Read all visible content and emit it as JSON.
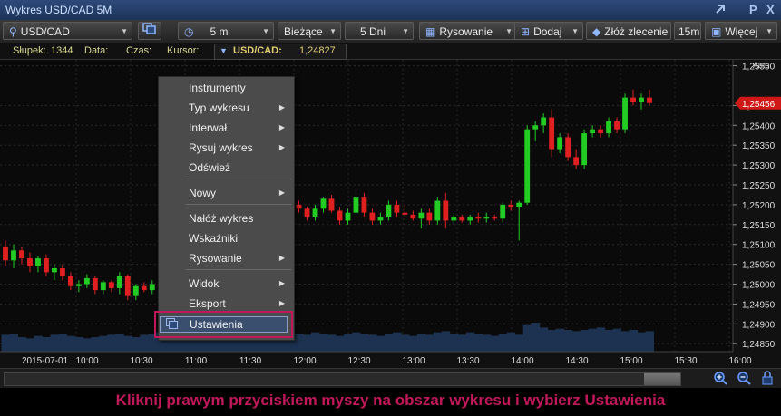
{
  "window": {
    "title": "Wykres USD/CAD 5M",
    "pin_glyph": "P",
    "close_glyph": "X"
  },
  "toolbar": {
    "symbol": "USD/CAD",
    "interval": "5 m",
    "type": "Bieżące",
    "range": "5 Dni",
    "draw": "Rysowanie",
    "add": "Dodaj",
    "order": "Złóż zlecenie",
    "quick_interval": "15m",
    "more": "Więcej"
  },
  "infobar": {
    "bar_label": "Słupek:",
    "bar_value": "1344",
    "date_label": "Data:",
    "time_label": "Czas:",
    "cursor_label": "Kursor:",
    "pair": "USD/CAD:",
    "price": "1,24827"
  },
  "price_axis": {
    "auto_label": "Auto",
    "labels": [
      "1,25550",
      "1,25450",
      "1,25400",
      "1,25350",
      "1,25300",
      "1,25250",
      "1,25200",
      "1,25150",
      "1,25100",
      "1,25050",
      "1,25000",
      "1,24950",
      "1,24900",
      "1,24850"
    ],
    "current_price": "1,25456"
  },
  "time_axis": {
    "labels": [
      "2015-07-01",
      "10:00",
      "10:30",
      "11:00",
      "11:30",
      "12:00",
      "12:30",
      "13:00",
      "13:30",
      "14:00",
      "14:30",
      "15:00",
      "15:30",
      "16:00"
    ]
  },
  "context_menu": {
    "items": [
      {
        "label": "Instrumenty",
        "submenu": false
      },
      {
        "label": "Typ wykresu",
        "submenu": true
      },
      {
        "label": "Interwał",
        "submenu": true
      },
      {
        "label": "Rysuj wykres",
        "submenu": true
      },
      {
        "label": "Odśwież",
        "submenu": false
      },
      {
        "label": "Nowy",
        "submenu": true
      },
      {
        "label": "Nałóż wykres",
        "submenu": false
      },
      {
        "label": "Wskaźniki",
        "submenu": false
      },
      {
        "label": "Rysowanie",
        "submenu": true
      },
      {
        "label": "Widok",
        "submenu": true
      },
      {
        "label": "Eksport",
        "submenu": true
      },
      {
        "label": "Ustawienia",
        "submenu": false
      }
    ]
  },
  "caption": "Kliknij prawym przyciskiem myszy na obszar wykresu i wybierz Ustawienia",
  "colors": {
    "up": "#22cc22",
    "down": "#e02020",
    "accent": "#c2185b",
    "background": "#0a0a0a"
  },
  "chart_data": {
    "type": "candlestick",
    "candles": [
      {
        "o": 1.25095,
        "h": 1.2511,
        "l": 1.25045,
        "c": 1.2506
      },
      {
        "o": 1.2506,
        "h": 1.251,
        "l": 1.2504,
        "c": 1.25085
      },
      {
        "o": 1.25085,
        "h": 1.25095,
        "l": 1.2505,
        "c": 1.25065
      },
      {
        "o": 1.25065,
        "h": 1.2508,
        "l": 1.2503,
        "c": 1.25045
      },
      {
        "o": 1.25045,
        "h": 1.2507,
        "l": 1.2503,
        "c": 1.25065
      },
      {
        "o": 1.25065,
        "h": 1.25075,
        "l": 1.2502,
        "c": 1.2503
      },
      {
        "o": 1.2503,
        "h": 1.2505,
        "l": 1.2501,
        "c": 1.2504
      },
      {
        "o": 1.2504,
        "h": 1.2505,
        "l": 1.2501,
        "c": 1.2502
      },
      {
        "o": 1.2502,
        "h": 1.2503,
        "l": 1.24985,
        "c": 1.24995
      },
      {
        "o": 1.24995,
        "h": 1.2501,
        "l": 1.2498,
        "c": 1.25
      },
      {
        "o": 1.25,
        "h": 1.25025,
        "l": 1.2499,
        "c": 1.25015
      },
      {
        "o": 1.25015,
        "h": 1.2502,
        "l": 1.24975,
        "c": 1.24985
      },
      {
        "o": 1.24985,
        "h": 1.2501,
        "l": 1.24975,
        "c": 1.25005
      },
      {
        "o": 1.25005,
        "h": 1.2501,
        "l": 1.2498,
        "c": 1.2499
      },
      {
        "o": 1.2499,
        "h": 1.2503,
        "l": 1.24975,
        "c": 1.2502
      },
      {
        "o": 1.2502,
        "h": 1.25025,
        "l": 1.2496,
        "c": 1.2497
      },
      {
        "o": 1.2497,
        "h": 1.25,
        "l": 1.2496,
        "c": 1.24995
      },
      {
        "o": 1.24995,
        "h": 1.25005,
        "l": 1.2498,
        "c": 1.24985
      },
      {
        "o": 1.24985,
        "h": 1.2501,
        "l": 1.24975,
        "c": 1.25
      },
      {
        "o": 1.25,
        "h": 1.2501,
        "l": 1.24985,
        "c": 1.24995
      },
      {
        "o": 1.24995,
        "h": 1.2501,
        "l": 1.2498,
        "c": 1.25005
      },
      {
        "o": 1.25005,
        "h": 1.25015,
        "l": 1.2499,
        "c": 1.25
      },
      {
        "o": 1.25,
        "h": 1.25015,
        "l": 1.2499,
        "c": 1.25005
      },
      {
        "o": 1.25005,
        "h": 1.25015,
        "l": 1.24995,
        "c": 1.25
      },
      {
        "o": 1.25,
        "h": 1.25015,
        "l": 1.24995,
        "c": 1.2501
      },
      {
        "o": 1.2501,
        "h": 1.2502,
        "l": 1.25,
        "c": 1.25005
      },
      {
        "o": 1.25005,
        "h": 1.2502,
        "l": 1.25,
        "c": 1.25015
      },
      {
        "o": 1.25015,
        "h": 1.25025,
        "l": 1.25005,
        "c": 1.2501
      },
      {
        "o": 1.2501,
        "h": 1.25025,
        "l": 1.25005,
        "c": 1.2502
      },
      {
        "o": 1.2502,
        "h": 1.25035,
        "l": 1.2501,
        "c": 1.2503
      },
      {
        "o": 1.2503,
        "h": 1.2505,
        "l": 1.2502,
        "c": 1.2504
      },
      {
        "o": 1.2504,
        "h": 1.2508,
        "l": 1.2503,
        "c": 1.2507
      },
      {
        "o": 1.2507,
        "h": 1.2512,
        "l": 1.2506,
        "c": 1.2511
      },
      {
        "o": 1.2511,
        "h": 1.2516,
        "l": 1.251,
        "c": 1.2515
      },
      {
        "o": 1.2515,
        "h": 1.2522,
        "l": 1.2514,
        "c": 1.2521
      },
      {
        "o": 1.2521,
        "h": 1.2522,
        "l": 1.2519,
        "c": 1.252
      },
      {
        "o": 1.252,
        "h": 1.2521,
        "l": 1.2518,
        "c": 1.2519
      },
      {
        "o": 1.2519,
        "h": 1.25195,
        "l": 1.2516,
        "c": 1.2517
      },
      {
        "o": 1.2517,
        "h": 1.252,
        "l": 1.2516,
        "c": 1.2519
      },
      {
        "o": 1.2519,
        "h": 1.2522,
        "l": 1.2518,
        "c": 1.25215
      },
      {
        "o": 1.25215,
        "h": 1.25225,
        "l": 1.2518,
        "c": 1.25185
      },
      {
        "o": 1.25185,
        "h": 1.25195,
        "l": 1.2515,
        "c": 1.2516
      },
      {
        "o": 1.2516,
        "h": 1.2519,
        "l": 1.2515,
        "c": 1.2518
      },
      {
        "o": 1.2518,
        "h": 1.2524,
        "l": 1.2517,
        "c": 1.2522
      },
      {
        "o": 1.2522,
        "h": 1.2523,
        "l": 1.2517,
        "c": 1.2518
      },
      {
        "o": 1.2518,
        "h": 1.2519,
        "l": 1.2515,
        "c": 1.2516
      },
      {
        "o": 1.2516,
        "h": 1.2518,
        "l": 1.2515,
        "c": 1.2517
      },
      {
        "o": 1.2517,
        "h": 1.2521,
        "l": 1.2516,
        "c": 1.252
      },
      {
        "o": 1.252,
        "h": 1.2521,
        "l": 1.2517,
        "c": 1.2518
      },
      {
        "o": 1.2518,
        "h": 1.252,
        "l": 1.2516,
        "c": 1.25175
      },
      {
        "o": 1.25175,
        "h": 1.25185,
        "l": 1.2516,
        "c": 1.25165
      },
      {
        "o": 1.25165,
        "h": 1.2519,
        "l": 1.2514,
        "c": 1.2518
      },
      {
        "o": 1.2518,
        "h": 1.2519,
        "l": 1.2515,
        "c": 1.2516
      },
      {
        "o": 1.2516,
        "h": 1.2522,
        "l": 1.2515,
        "c": 1.2521
      },
      {
        "o": 1.2521,
        "h": 1.2523,
        "l": 1.2514,
        "c": 1.2516
      },
      {
        "o": 1.2516,
        "h": 1.25175,
        "l": 1.2515,
        "c": 1.2517
      },
      {
        "o": 1.2517,
        "h": 1.25175,
        "l": 1.25155,
        "c": 1.2516
      },
      {
        "o": 1.2516,
        "h": 1.25175,
        "l": 1.2515,
        "c": 1.2517
      },
      {
        "o": 1.2517,
        "h": 1.2518,
        "l": 1.25155,
        "c": 1.25165
      },
      {
        "o": 1.25165,
        "h": 1.2518,
        "l": 1.25155,
        "c": 1.2517
      },
      {
        "o": 1.2517,
        "h": 1.25175,
        "l": 1.2516,
        "c": 1.25165
      },
      {
        "o": 1.25165,
        "h": 1.25205,
        "l": 1.25155,
        "c": 1.252
      },
      {
        "o": 1.252,
        "h": 1.2521,
        "l": 1.25185,
        "c": 1.25195
      },
      {
        "o": 1.25195,
        "h": 1.2521,
        "l": 1.2511,
        "c": 1.25205
      },
      {
        "o": 1.25205,
        "h": 1.254,
        "l": 1.252,
        "c": 1.2539
      },
      {
        "o": 1.2539,
        "h": 1.2541,
        "l": 1.2536,
        "c": 1.254
      },
      {
        "o": 1.254,
        "h": 1.2543,
        "l": 1.2538,
        "c": 1.2542
      },
      {
        "o": 1.2542,
        "h": 1.2544,
        "l": 1.2532,
        "c": 1.2534
      },
      {
        "o": 1.2534,
        "h": 1.2538,
        "l": 1.2533,
        "c": 1.2537
      },
      {
        "o": 1.2537,
        "h": 1.2538,
        "l": 1.2531,
        "c": 1.2532
      },
      {
        "o": 1.2532,
        "h": 1.2534,
        "l": 1.2529,
        "c": 1.253
      },
      {
        "o": 1.253,
        "h": 1.2539,
        "l": 1.2529,
        "c": 1.2538
      },
      {
        "o": 1.2538,
        "h": 1.254,
        "l": 1.2537,
        "c": 1.2539
      },
      {
        "o": 1.2539,
        "h": 1.254,
        "l": 1.2537,
        "c": 1.2538
      },
      {
        "o": 1.2538,
        "h": 1.2542,
        "l": 1.2537,
        "c": 1.2541
      },
      {
        "o": 1.2541,
        "h": 1.2542,
        "l": 1.2538,
        "c": 1.2539
      },
      {
        "o": 1.2539,
        "h": 1.2548,
        "l": 1.2538,
        "c": 1.2547
      },
      {
        "o": 1.2547,
        "h": 1.2549,
        "l": 1.2545,
        "c": 1.2546
      },
      {
        "o": 1.2546,
        "h": 1.2548,
        "l": 1.2544,
        "c": 1.2547
      },
      {
        "o": 1.2547,
        "h": 1.2549,
        "l": 1.2545,
        "c": 1.25456
      }
    ],
    "volume": [
      14,
      15,
      12,
      11,
      13,
      12,
      14,
      15,
      13,
      12,
      11,
      12,
      13,
      14,
      15,
      13,
      12,
      14,
      15,
      16,
      14,
      13,
      12,
      14,
      15,
      14,
      13,
      12,
      14,
      16,
      17,
      18,
      16,
      15,
      17,
      16,
      15,
      14,
      16,
      15,
      14,
      13,
      15,
      16,
      15,
      14,
      13,
      15,
      16,
      14,
      13,
      15,
      14,
      16,
      17,
      15,
      14,
      16,
      15,
      14,
      13,
      15,
      16,
      14,
      22,
      24,
      20,
      18,
      19,
      18,
      17,
      18,
      19,
      20,
      18,
      19,
      17,
      18,
      16,
      17
    ],
    "ylim": [
      1.2483,
      1.25565
    ]
  }
}
